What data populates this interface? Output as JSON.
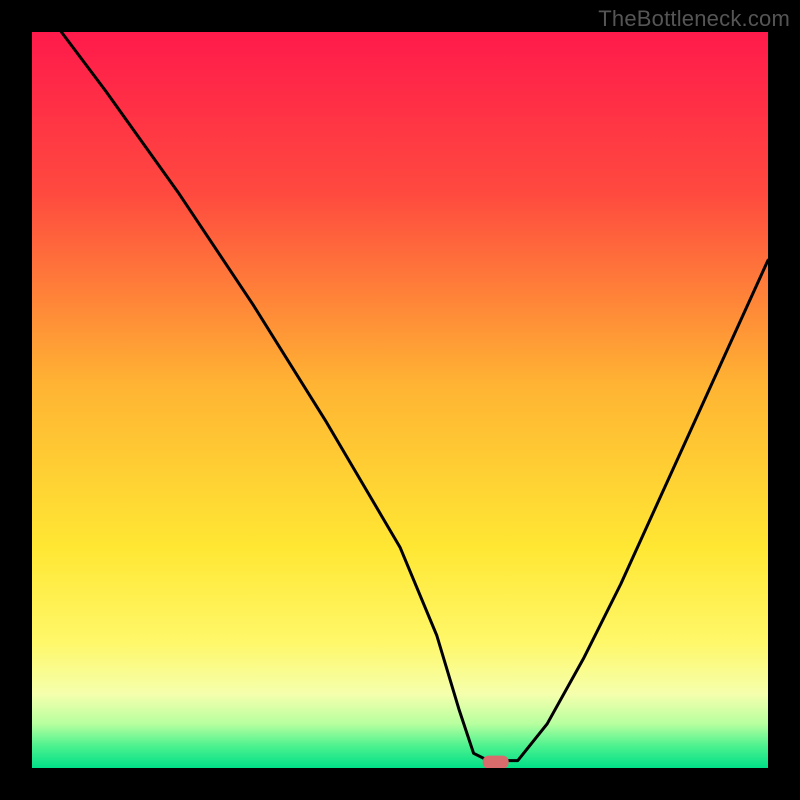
{
  "watermark": "TheBottleneck.com",
  "chart_data": {
    "type": "line",
    "title": "",
    "xlabel": "",
    "ylabel": "",
    "xlim": [
      0,
      100
    ],
    "ylim": [
      0,
      100
    ],
    "series": [
      {
        "name": "bottleneck-curve",
        "x": [
          4,
          10,
          20,
          30,
          40,
          50,
          55,
          58,
          60,
          62,
          66,
          70,
          75,
          80,
          85,
          90,
          95,
          100
        ],
        "y": [
          100,
          92,
          78,
          63,
          47,
          30,
          18,
          8,
          2,
          1,
          1,
          6,
          15,
          25,
          36,
          47,
          58,
          69
        ]
      }
    ],
    "marker": {
      "x": 63,
      "y": 0.8,
      "color": "#d86b6b"
    },
    "gradient_stops": [
      {
        "pct": 0,
        "color": "#ff1a4b"
      },
      {
        "pct": 22,
        "color": "#ff4a3f"
      },
      {
        "pct": 48,
        "color": "#ffb433"
      },
      {
        "pct": 70,
        "color": "#ffe733"
      },
      {
        "pct": 83,
        "color": "#fff86a"
      },
      {
        "pct": 90,
        "color": "#f5ffad"
      },
      {
        "pct": 94,
        "color": "#b7ff9f"
      },
      {
        "pct": 97,
        "color": "#4df28f"
      },
      {
        "pct": 100,
        "color": "#00df87"
      }
    ]
  }
}
